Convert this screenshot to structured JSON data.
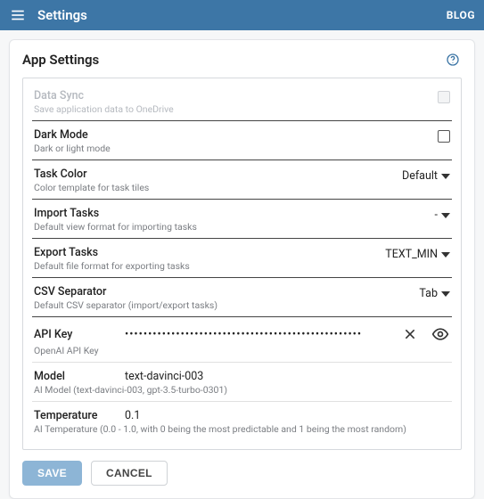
{
  "toolbar": {
    "title": "Settings",
    "blog_link": "BLOG"
  },
  "card": {
    "title": "App Settings",
    "help_tooltip": "Help"
  },
  "settings": {
    "data_sync": {
      "label": "Data Sync",
      "sub": "Save application data to OneDrive",
      "checked": false,
      "disabled": true
    },
    "dark_mode": {
      "label": "Dark Mode",
      "sub": "Dark or light mode",
      "checked": false
    },
    "task_color": {
      "label": "Task Color",
      "sub": "Color template for task tiles",
      "value": "Default"
    },
    "import_tasks": {
      "label": "Import Tasks",
      "sub": "Default view format for importing tasks",
      "value": "-"
    },
    "export_tasks": {
      "label": "Export Tasks",
      "sub": "Default file format for exporting tasks",
      "value": "TEXT_MIN"
    },
    "csv_separator": {
      "label": "CSV Separator",
      "sub": "Default CSV separator (import/export tasks)",
      "value": "Tab"
    },
    "api_key": {
      "label": "API Key",
      "sub": "OpenAI API Key",
      "masked_value": "•••••••••••••••••••••••••••••••••••••••••••••••••••"
    },
    "model": {
      "label": "Model",
      "sub": "AI Model (text-davinci-003, gpt-3.5-turbo-0301)",
      "value": "text-davinci-003"
    },
    "temperature": {
      "label": "Temperature",
      "sub": "AI Temperature (0.0 - 1.0, with 0 being the most predictable and 1 being the most random)",
      "value": "0.1"
    }
  },
  "buttons": {
    "save": "SAVE",
    "cancel": "CANCEL"
  }
}
